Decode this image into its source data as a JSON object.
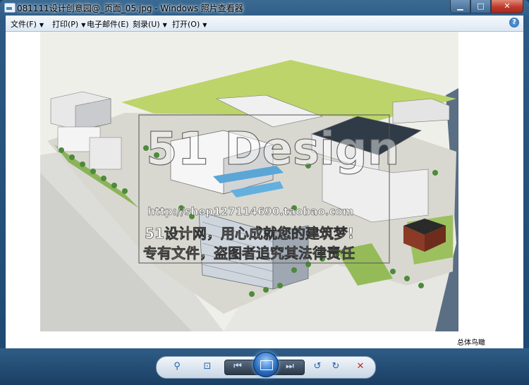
{
  "window": {
    "title": "081111设计创意园@_页面_05.jpg - Windows 照片查看器",
    "minimize_glyph": "▁",
    "maximize_glyph": "□",
    "close_glyph": "✕"
  },
  "menu": {
    "items": [
      {
        "label": "文件(F)",
        "caret": "▼"
      },
      {
        "label": "打印(P)",
        "caret": "▼"
      },
      {
        "label": "电子邮件(E)"
      },
      {
        "label": "刻录(U)",
        "caret": "▼"
      },
      {
        "label": "打开(O)",
        "caret": "▼"
      }
    ],
    "help_glyph": "?"
  },
  "image": {
    "watermark_logo": "51 Design",
    "watermark_url": "http://shop127114690.taobao.com",
    "watermark_line1": "51设计网，用心成就您的建筑梦!",
    "watermark_line2": "专有文件，盗图者追究其法律责任",
    "caption": "总体鸟瞰"
  },
  "toolbar": {
    "zoom_glyph": "⚲",
    "fit_glyph": "⊡",
    "prev_glyph": "⏮",
    "next_glyph": "⏭",
    "rotate_ccw_glyph": "↺",
    "rotate_cw_glyph": "↻",
    "delete_glyph": "✕"
  }
}
